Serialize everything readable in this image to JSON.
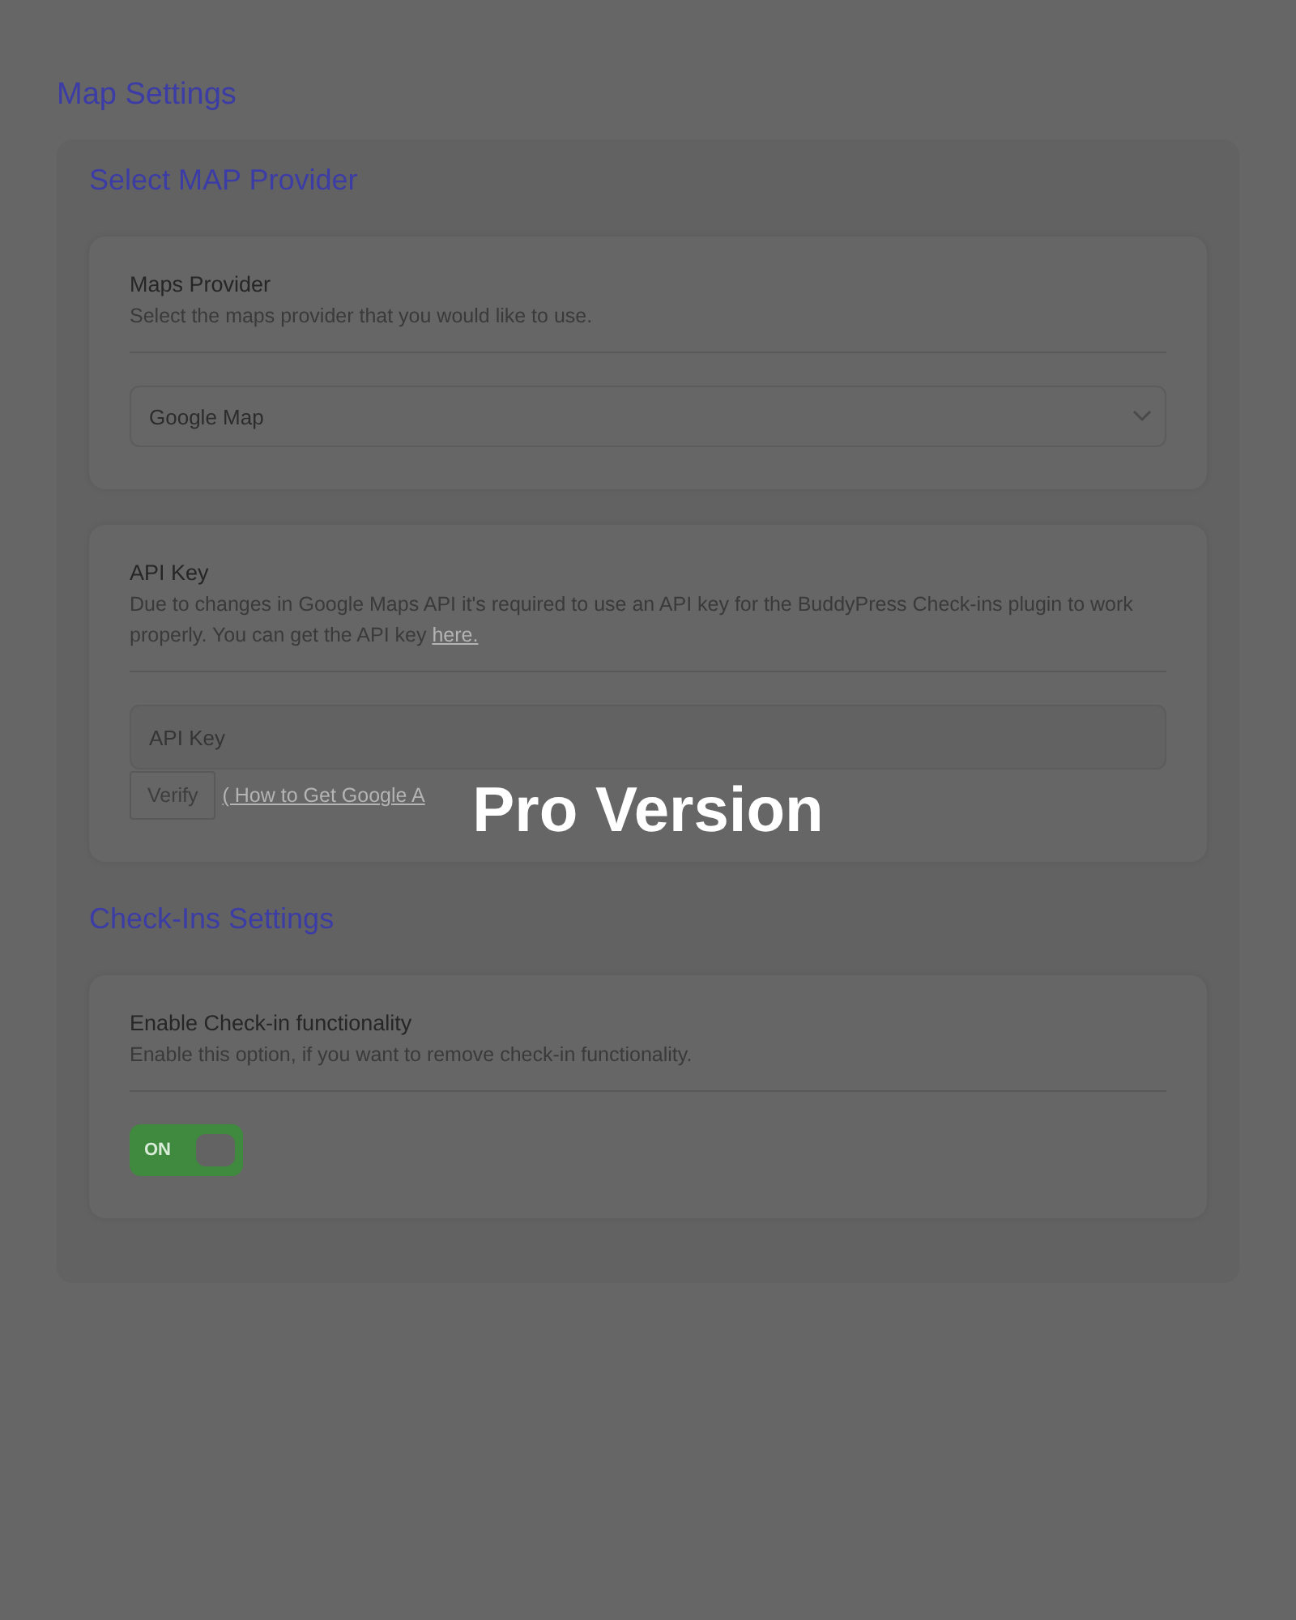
{
  "page_title": "Map Settings",
  "sections": [
    {
      "heading": "Select MAP Provider",
      "cards": [
        {
          "kind": "select",
          "title": "Maps Provider",
          "description": "Select the maps provider that you would like to use.",
          "value": "Google Map"
        },
        {
          "kind": "api_key",
          "title": "API Key",
          "description": "Due to changes in Google Maps API it's required to use an API key for the BuddyPress Check-ins plugin to work properly. You can get the API key ",
          "description_link": "here.",
          "placeholder": "API Key",
          "button": "Verify",
          "help_link": "( How to Get Google A"
        }
      ]
    },
    {
      "heading": "Check-Ins Settings",
      "cards": [
        {
          "kind": "toggle",
          "title": "Enable Check-in functionality",
          "description": "Enable this option, if you want to remove check-in functionality.",
          "on": true,
          "toggle_label": "ON"
        }
      ]
    }
  ],
  "overlay": {
    "label": "Pro Version"
  }
}
